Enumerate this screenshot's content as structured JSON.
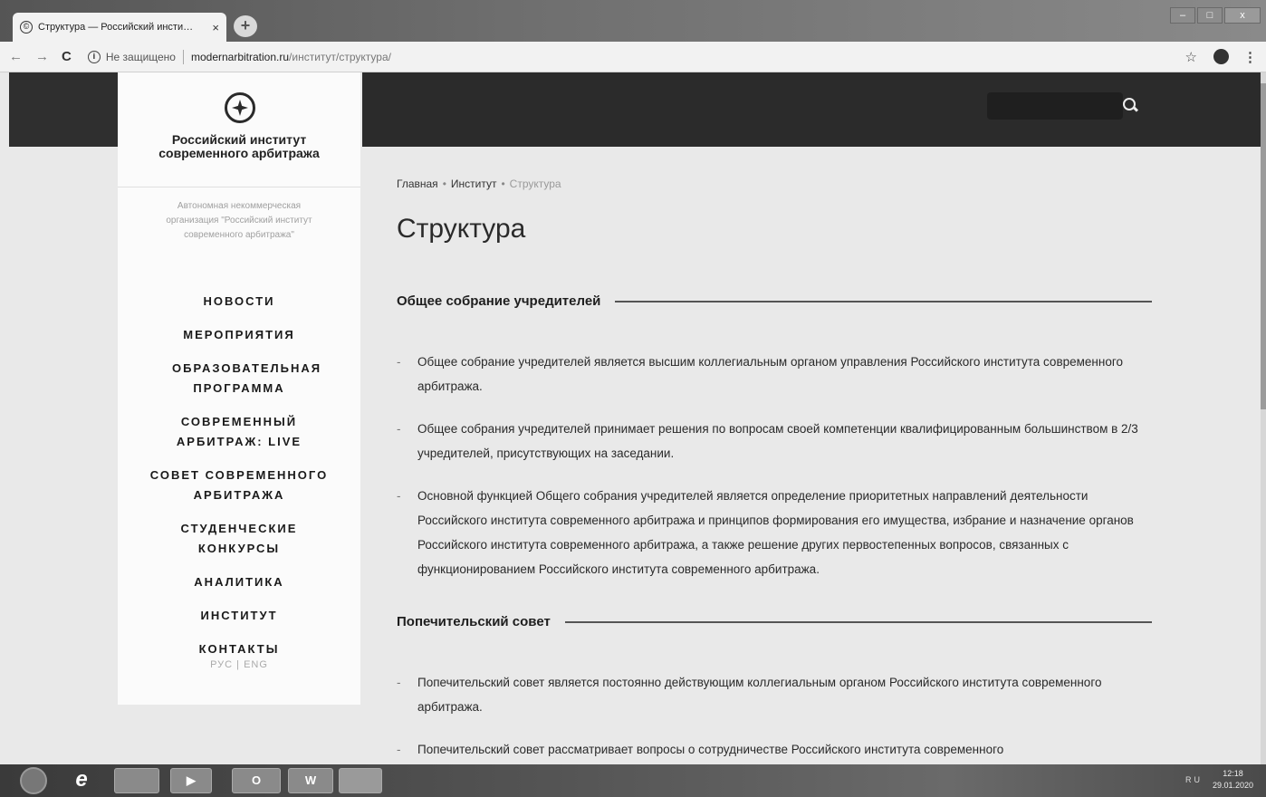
{
  "browser": {
    "tab_title": "Структура — Российский инсти…",
    "tab_close": "×",
    "new_tab": "+",
    "security_label": "Не защищено",
    "url_domain": "modernarbitration.ru",
    "url_path": "/институт/структура/",
    "window_controls": [
      "–",
      "□",
      "x"
    ]
  },
  "site": {
    "logo_title_line1": "Российский институт",
    "logo_title_line2": "современного арбитража",
    "tagline": "Автономная некоммерческая организация \"Российский институт современного арбитража\"",
    "menu": [
      "НОВОСТИ",
      "МЕРОПРИЯТИЯ",
      "ОБРАЗОВАТЕЛЬНАЯ ПРОГРАММА",
      "СОВРЕМЕННЫЙ АРБИТРАЖ: LIVE",
      "СОВЕТ СОВРЕМЕННОГО АРБИТРАЖА",
      "СТУДЕНЧЕСКИЕ КОНКУРСЫ",
      "АНАЛИТИКА",
      "ИНСТИТУТ",
      "КОНТАКТЫ"
    ],
    "lang_switch": "РУС | ENG"
  },
  "breadcrumb": {
    "home": "Главная",
    "parent": "Институт",
    "current": "Структура",
    "separator": "•"
  },
  "page_title": "Структура",
  "sections": [
    {
      "heading": "Общее собрание учредителей",
      "bullets": [
        "Общее собрание учредителей является высшим коллегиальным органом управления Российского института современного арбитража.",
        "Общее собрания учредителей принимает решения по вопросам своей компетенции квалифицированным большинством в 2/3 учредителей, присутствующих на заседании.",
        "Основной функцией Общего собрания учредителей является определение приоритетных направлений деятельности Российского института современного арбитража и принципов формирования его имущества, избрание и назначение органов Российского института современного арбитража, а также решение других первостепенных вопросов, связанных с функционированием Российского института современного арбитража."
      ]
    },
    {
      "heading": "Попечительский совет",
      "bullets": [
        "Попечительский совет является постоянно действующим коллегиальным органом Российского института современного арбитража.",
        "Попечительский совет рассматривает вопросы о сотрудничестве Российского института современного"
      ]
    }
  ],
  "bullet_dash": "-",
  "taskbar": {
    "items": [
      "e",
      "",
      "▶",
      "O",
      "W",
      ""
    ],
    "tray": "RU",
    "time": "12:18",
    "date": "29.01.2020"
  }
}
